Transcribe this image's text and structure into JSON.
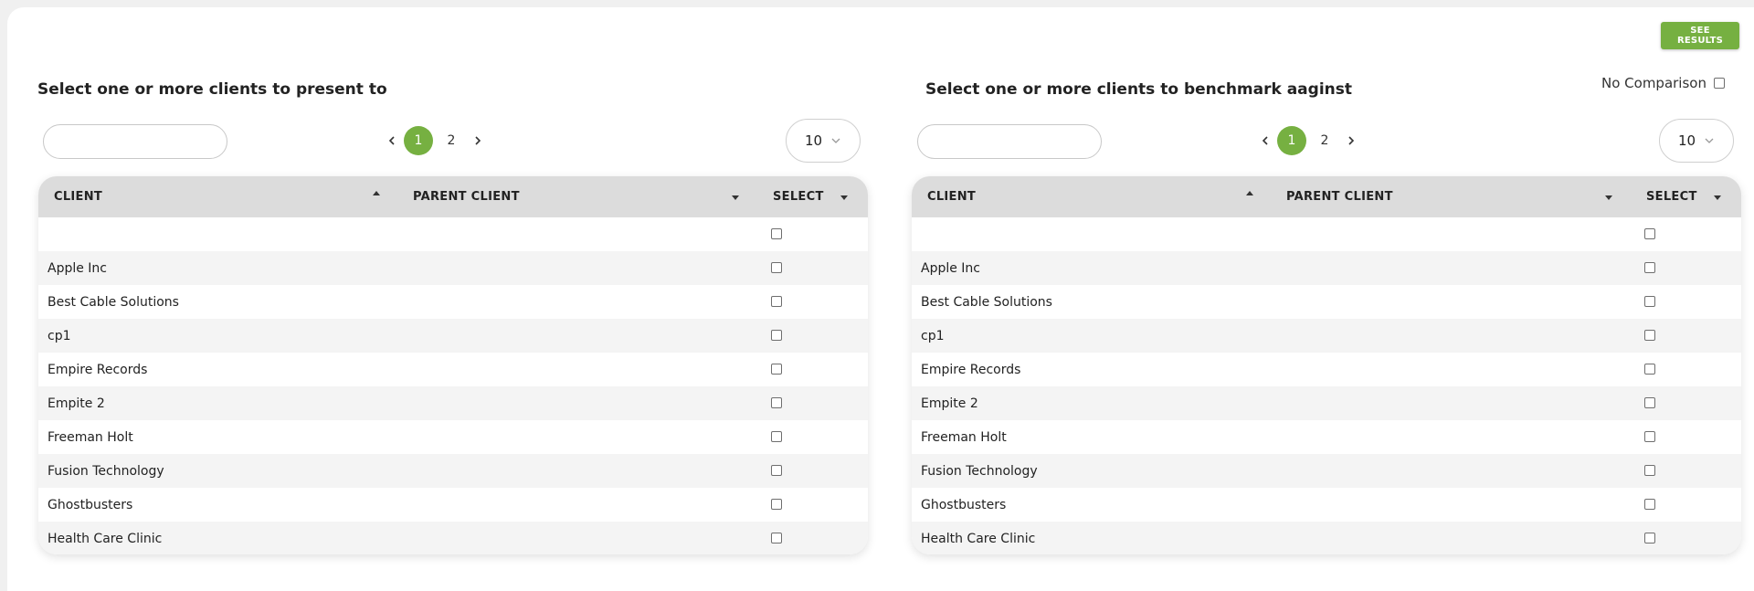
{
  "actions": {
    "see_results": "SEE RESULTS"
  },
  "left": {
    "title": "Select one or more clients to present to",
    "search_value": "",
    "pagination": {
      "pages": [
        "1",
        "2"
      ],
      "current": "1"
    },
    "page_size": "10",
    "columns": {
      "client": "CLIENT",
      "parent": "PARENT CLIENT",
      "select": "SELECT"
    },
    "rows": [
      "",
      "Apple Inc",
      "Best Cable Solutions",
      "cp1",
      "Empire Records",
      "Empite 2",
      "Freeman Holt",
      "Fusion Technology",
      "Ghostbusters",
      "Health Care Clinic"
    ]
  },
  "right": {
    "title": "Select one or more clients to benchmark aaginst",
    "no_comparison_label": "No Comparison",
    "search_value": "",
    "pagination": {
      "pages": [
        "1",
        "2"
      ],
      "current": "1"
    },
    "page_size": "10",
    "columns": {
      "client": "CLIENT",
      "parent": "PARENT CLIENT",
      "select": "SELECT"
    },
    "rows": [
      "",
      "Apple Inc",
      "Best Cable Solutions",
      "cp1",
      "Empire Records",
      "Empite 2",
      "Freeman Holt",
      "Fusion Technology",
      "Ghostbusters",
      "Health Care Clinic"
    ]
  },
  "icons": {
    "prev": "chevron-left-icon",
    "next": "chevron-right-icon",
    "dropdown": "chevron-down-icon",
    "sort_asc": "sort-up-icon",
    "sort_desc": "sort-down-icon"
  },
  "colors": {
    "accent": "#76b041",
    "header_bg": "#dcdcdc",
    "stripe": "#f4f4f4"
  }
}
